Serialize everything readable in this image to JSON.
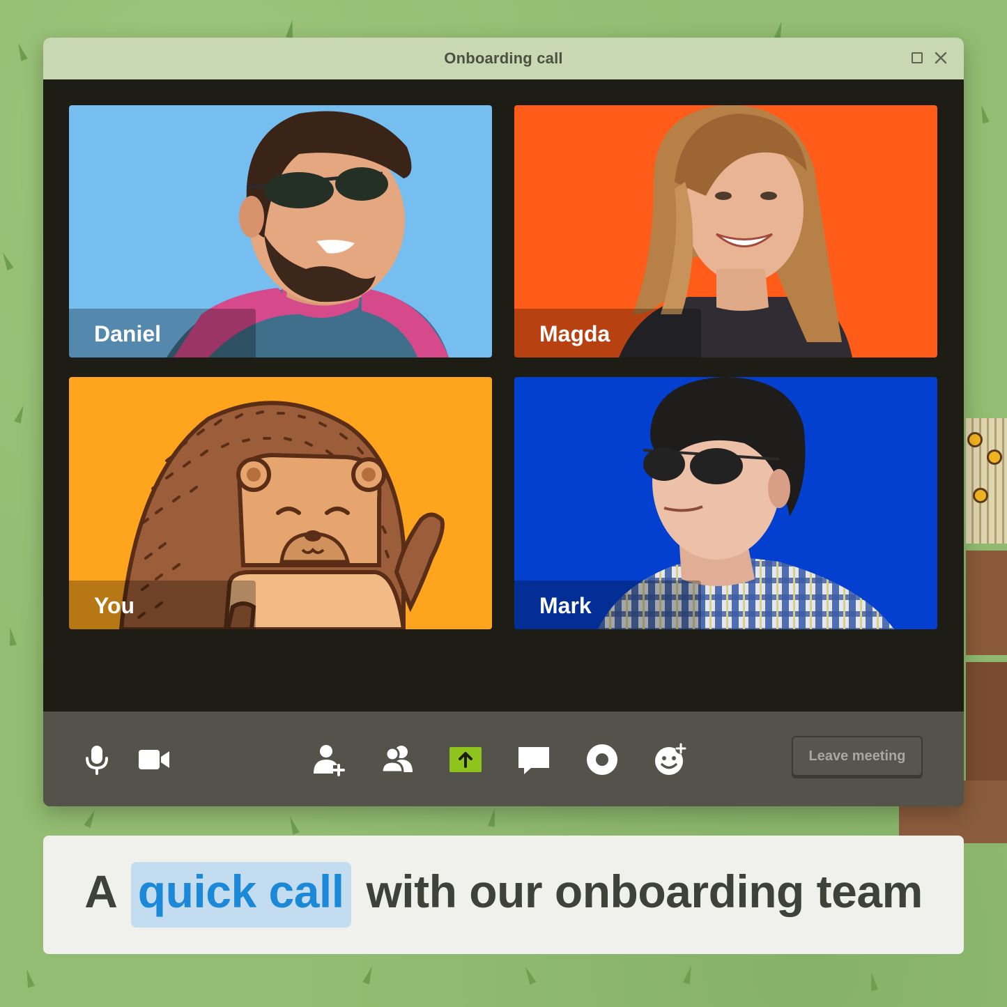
{
  "window": {
    "title": "Onboarding call"
  },
  "participants": [
    {
      "id": "daniel",
      "name": "Daniel",
      "bg": "#76bdf0"
    },
    {
      "id": "magda",
      "name": "Magda",
      "bg": "#ff5b19"
    },
    {
      "id": "you",
      "name": "You",
      "bg": "#fea51d"
    },
    {
      "id": "mark",
      "name": "Mark",
      "bg": "#0340cf"
    }
  ],
  "toolbar": {
    "icons": [
      "microphone-icon",
      "camera-icon",
      "add-person-icon",
      "participants-icon",
      "share-screen-icon",
      "chat-icon",
      "record-icon",
      "add-reaction-icon"
    ],
    "share_color": "#8fc41d",
    "leave_label": "Leave meeting"
  },
  "caption": {
    "prefix": "A",
    "highlight": "quick call",
    "suffix": "with our onboarding team",
    "highlight_color": "#1b88d8"
  }
}
